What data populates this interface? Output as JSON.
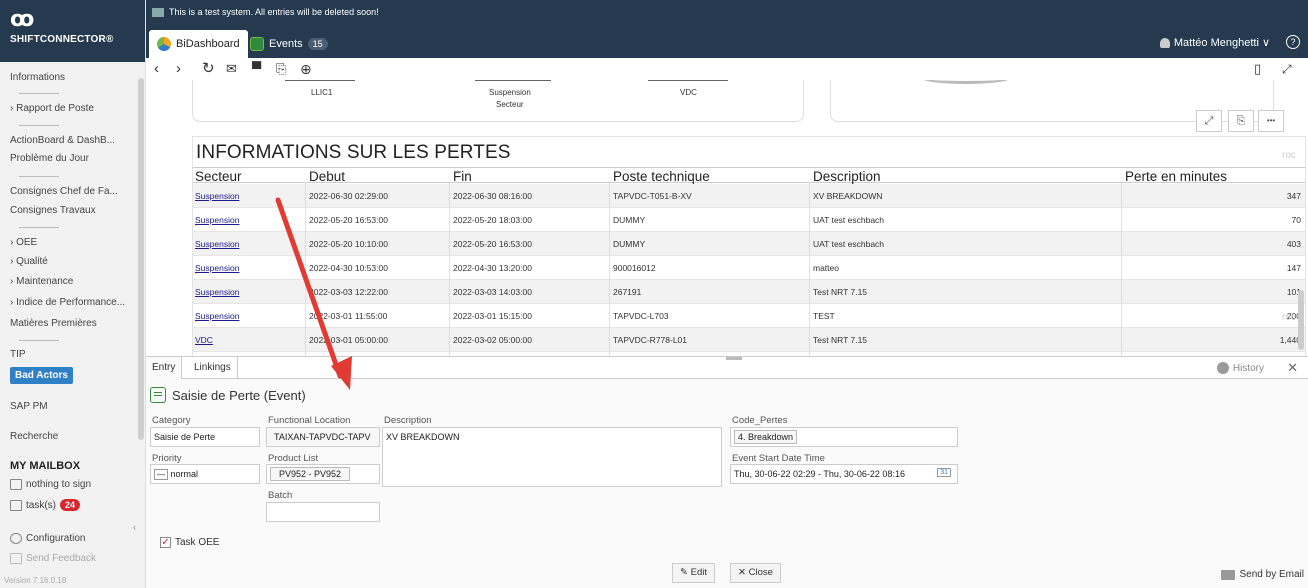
{
  "brand": {
    "logo": "ꝏ",
    "name": "SHIFTCONNECTOR®"
  },
  "sidebar": {
    "items": [
      "Informations",
      "› Rapport de Poste",
      "ActionBoard & DashB...",
      "Problème du Jour",
      "Consignes Chef de Fa...",
      "Consignes Travaux",
      "› OEE",
      "› Qualité",
      "› Maintenance",
      "› Indice de Performance...",
      "Matières Premières",
      "TIP",
      "Bad Actors",
      "SAP PM",
      "Recherche"
    ],
    "mailbox_title": "MY MAILBOX",
    "nothing_to_sign": "nothing to sign",
    "tasks_label": "task(s)",
    "tasks_count": "24",
    "configuration": "Configuration",
    "send_feedback": "Send Feedback",
    "version": "Version 7.16.0.18"
  },
  "header": {
    "test_message": "This is a test system. All entries will be deleted soon!",
    "tabs": [
      {
        "label": "BiDashboard"
      },
      {
        "label": "Events",
        "count": "15"
      }
    ],
    "user": "Mattéo Menghetti ∨",
    "help": "?"
  },
  "toolbar": {
    "icons": [
      "back-icon",
      "forward-icon",
      "refresh-icon",
      "mail-icon",
      "print-icon",
      "export-icon",
      "zoom-in-icon",
      "bookmark-icon",
      "fullscreen-icon"
    ]
  },
  "dashboard": {
    "chart_categories": [
      "LLIC1",
      "Suspension",
      "VDC"
    ],
    "chart_axis_label": "Secteur",
    "card_buttons": [
      "expand-icon",
      "export-icon",
      "more-icon"
    ],
    "card_more": "•••",
    "grid": {
      "title": "INFORMATIONS SUR LES PERTES",
      "columns": [
        "Secteur",
        "Debut",
        "Fin",
        "Poste technique",
        "Description",
        "Perte en minutes"
      ],
      "rows": [
        [
          "Suspension",
          "2022-06-30 02:29:00",
          "2022-06-30 08:16:00",
          "TAPVDC-T051-B-XV",
          "XV BREAKDOWN",
          "347"
        ],
        [
          "Suspension",
          "2022-05-20 16:53:00",
          "2022-05-20 18:03:00",
          "DUMMY",
          "UAT test eschbach",
          "70"
        ],
        [
          "Suspension",
          "2022-05-20 10:10:00",
          "2022-05-20 16:53:00",
          "DUMMY",
          "UAT test eschbach",
          "403"
        ],
        [
          "Suspension",
          "2022-04-30 10:53:00",
          "2022-04-30 13:20:00",
          "900016012",
          "matteo",
          "147"
        ],
        [
          "Suspension",
          "2022-03-03 12:22:00",
          "2022-03-03 14:03:00",
          "267191",
          "Test NRT 7.15",
          "101"
        ],
        [
          "Suspension",
          "2022-03-01 11:55:00",
          "2022-03-01 15:15:00",
          "TAPVDC-L703",
          "TEST",
          "200"
        ],
        [
          "VDC",
          "2022-03-01 05:00:00",
          "2022-03-02 05:00:00",
          "TAPVDC-R778-L01",
          "Test NRT 7.15",
          "1,440"
        ]
      ]
    },
    "watermark": "roc"
  },
  "panel": {
    "tabs": [
      "Entry",
      "Linkings"
    ],
    "history": "History",
    "close": "✕",
    "event_title": "Saisie de Perte (Event)",
    "fields": {
      "category_label": "Category",
      "category_value": "Saisie de Perte",
      "functional_location_label": "Functional Location",
      "functional_location_value": "TAIXAN-TAPVDC-TAPV",
      "description_label": "Description",
      "description_value": "XV BREAKDOWN",
      "code_pertes_label": "Code_Pertes",
      "code_pertes_value": "4. Breakdown",
      "priority_label": "Priority",
      "priority_value": "normal",
      "product_list_label": "Product List",
      "product_list_value": "PV952 - PV952",
      "event_start_label": "Event Start Date Time",
      "event_start_value": "Thu, 30-06-22 02:29 - Thu, 30-06-22 08:16",
      "calendar_day": "31",
      "batch_label": "Batch",
      "batch_value": ""
    },
    "task_oee": "Task OEE",
    "edit": "Edit",
    "close_button": "Close",
    "send_email": "Send by Email"
  },
  "colors": {
    "header_bg": "#253a4f",
    "accent": "#2f80c4",
    "badge_red": "#d9262c",
    "arrow": "#e23b33"
  }
}
